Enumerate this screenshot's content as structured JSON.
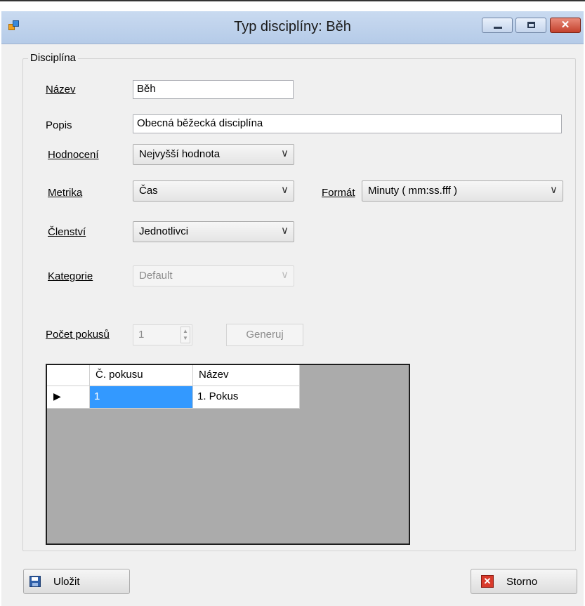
{
  "window": {
    "title": "Typ disciplíny: Běh",
    "minimize_icon": "minimize-icon",
    "maximize_icon": "maximize-icon",
    "close_icon": "close-icon",
    "close_glyph": "✕"
  },
  "group": {
    "label": "Disciplína"
  },
  "form": {
    "nazev_label": "Název",
    "nazev_value": "Běh",
    "popis_label": "Popis",
    "popis_value": "Obecná běžecká disciplína",
    "hodnoceni_label": "Hodnocení",
    "hodnoceni_value": "Nejvyšší hodnota",
    "metrika_label": "Metrika",
    "metrika_value": "Čas",
    "format_label": "Formát",
    "format_value": "Minuty ( mm:ss.fff )",
    "clenstvi_label": "Členství",
    "clenstvi_value": "Jednotlivci",
    "kategorie_label": "Kategorie",
    "kategorie_value": "Default",
    "pocet_label": "Počet pokusů",
    "pocet_value": "1",
    "generuj_label": "Generuj",
    "dropdown_glyph": "∨"
  },
  "grid": {
    "columns": [
      "Č. pokusu",
      "Název"
    ],
    "rows": [
      {
        "pokus": "1",
        "nazev": "1. Pokus",
        "current": true
      }
    ],
    "current_row_glyph": "▶"
  },
  "buttons": {
    "save_label": "Uložit",
    "save_icon": "save-icon",
    "cancel_label": "Storno",
    "cancel_icon": "cancel-icon",
    "cancel_glyph": "✕"
  }
}
